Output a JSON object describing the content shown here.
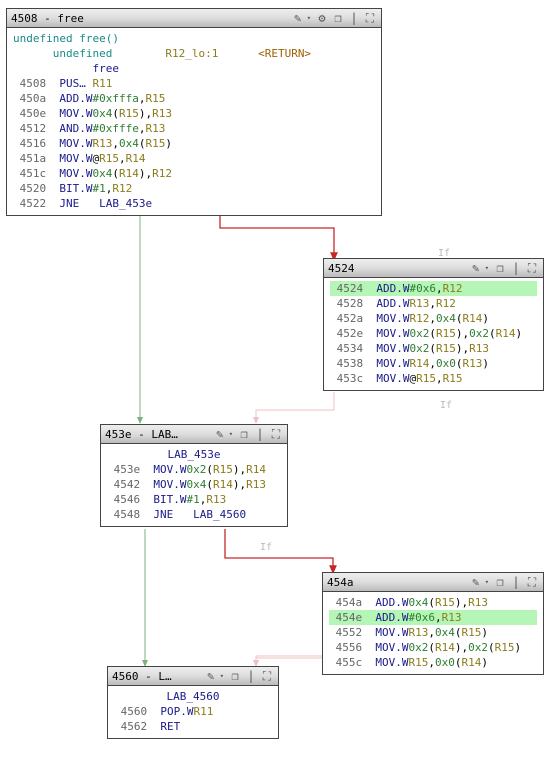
{
  "blocks": {
    "b4508": {
      "title": "4508 - free",
      "sig1": "undefined free()",
      "sig2": {
        "type": "undefined",
        "reg": "R12_lo:1",
        "ret": "<RETURN>"
      },
      "sig3": "free",
      "rows": [
        {
          "a": "4508",
          "t": [
            [
              "op",
              "PUS…"
            ],
            [
              "reg",
              " R11"
            ]
          ]
        },
        {
          "a": "450a",
          "t": [
            [
              "op",
              "ADD.W"
            ],
            [
              "hex",
              "#0xfffa"
            ],
            [
              "",
              ","
            ],
            [
              "reg",
              "R15"
            ]
          ]
        },
        {
          "a": "450e",
          "t": [
            [
              "op",
              "MOV.W"
            ],
            [
              "hex",
              "0x4"
            ],
            [
              "",
              "("
            ],
            [
              "reg",
              "R15"
            ],
            [
              "",
              ")"
            ],
            [
              "",
              ","
            ],
            [
              "reg",
              "R13"
            ]
          ]
        },
        {
          "a": "4512",
          "t": [
            [
              "op",
              "AND.W"
            ],
            [
              "hex",
              "#0xfffe"
            ],
            [
              "",
              ","
            ],
            [
              "reg",
              "R13"
            ]
          ]
        },
        {
          "a": "4516",
          "t": [
            [
              "op",
              "MOV.W"
            ],
            [
              "reg",
              "R13"
            ],
            [
              "",
              ","
            ],
            [
              "hex",
              "0x4"
            ],
            [
              "",
              "("
            ],
            [
              "reg",
              "R15"
            ],
            [
              "",
              ")"
            ]
          ]
        },
        {
          "a": "451a",
          "t": [
            [
              "op",
              "MOV.W"
            ],
            [
              "",
              "@"
            ],
            [
              "reg",
              "R15"
            ],
            [
              "",
              ","
            ],
            [
              "reg",
              "R14"
            ]
          ]
        },
        {
          "a": "451c",
          "t": [
            [
              "op",
              "MOV.W"
            ],
            [
              "hex",
              "0x4"
            ],
            [
              "",
              "("
            ],
            [
              "reg",
              "R14"
            ],
            [
              "",
              ")"
            ],
            [
              "",
              ","
            ],
            [
              "reg",
              "R12"
            ]
          ]
        },
        {
          "a": "4520",
          "t": [
            [
              "op",
              "BIT.W"
            ],
            [
              "hex",
              "#1"
            ],
            [
              "",
              ","
            ],
            [
              "reg",
              "R12"
            ]
          ]
        },
        {
          "a": "4522",
          "t": [
            [
              "op",
              "JNE"
            ],
            [
              "",
              "   "
            ],
            [
              "sym",
              "LAB_453e"
            ]
          ]
        }
      ]
    },
    "b4524": {
      "title": "4524",
      "rows": [
        {
          "a": "4524",
          "hl": true,
          "t": [
            [
              "op",
              "ADD.W"
            ],
            [
              "hex",
              "#0x6"
            ],
            [
              "",
              ","
            ],
            [
              "reg",
              "R12"
            ]
          ]
        },
        {
          "a": "4528",
          "t": [
            [
              "op",
              "ADD.W"
            ],
            [
              "reg",
              "R13"
            ],
            [
              "",
              ","
            ],
            [
              "reg",
              "R12"
            ]
          ]
        },
        {
          "a": "452a",
          "t": [
            [
              "op",
              "MOV.W"
            ],
            [
              "reg",
              "R12"
            ],
            [
              "",
              ","
            ],
            [
              "hex",
              "0x4"
            ],
            [
              "",
              "("
            ],
            [
              "reg",
              "R14"
            ],
            [
              "",
              ")"
            ]
          ]
        },
        {
          "a": "452e",
          "t": [
            [
              "op",
              "MOV.W"
            ],
            [
              "hex",
              "0x2"
            ],
            [
              "",
              "("
            ],
            [
              "reg",
              "R15"
            ],
            [
              "",
              ")"
            ],
            [
              "",
              ","
            ],
            [
              "hex",
              "0x2"
            ],
            [
              "",
              "("
            ],
            [
              "reg",
              "R14"
            ],
            [
              "",
              ")"
            ]
          ]
        },
        {
          "a": "4534",
          "t": [
            [
              "op",
              "MOV.W"
            ],
            [
              "hex",
              "0x2"
            ],
            [
              "",
              "("
            ],
            [
              "reg",
              "R15"
            ],
            [
              "",
              ")"
            ],
            [
              "",
              ","
            ],
            [
              "reg",
              "R13"
            ]
          ]
        },
        {
          "a": "4538",
          "t": [
            [
              "op",
              "MOV.W"
            ],
            [
              "reg",
              "R14"
            ],
            [
              "",
              ","
            ],
            [
              "hex",
              "0x0"
            ],
            [
              "",
              "("
            ],
            [
              "reg",
              "R13"
            ],
            [
              "",
              ")"
            ]
          ]
        },
        {
          "a": "453c",
          "t": [
            [
              "op",
              "MOV.W"
            ],
            [
              "",
              "@"
            ],
            [
              "reg",
              "R15"
            ],
            [
              "",
              ","
            ],
            [
              "reg",
              "R15"
            ]
          ]
        }
      ]
    },
    "b453e": {
      "title": "453e - LAB…",
      "label": "LAB_453e",
      "rows": [
        {
          "a": "453e",
          "t": [
            [
              "op",
              "MOV.W"
            ],
            [
              "hex",
              "0x2"
            ],
            [
              "",
              "("
            ],
            [
              "reg",
              "R15"
            ],
            [
              "",
              ")"
            ],
            [
              "",
              ","
            ],
            [
              "reg",
              "R14"
            ]
          ]
        },
        {
          "a": "4542",
          "t": [
            [
              "op",
              "MOV.W"
            ],
            [
              "hex",
              "0x4"
            ],
            [
              "",
              "("
            ],
            [
              "reg",
              "R14"
            ],
            [
              "",
              ")"
            ],
            [
              "",
              ","
            ],
            [
              "reg",
              "R13"
            ]
          ]
        },
        {
          "a": "4546",
          "t": [
            [
              "op",
              "BIT.W"
            ],
            [
              "hex",
              "#1"
            ],
            [
              "",
              ","
            ],
            [
              "reg",
              "R13"
            ]
          ]
        },
        {
          "a": "4548",
          "t": [
            [
              "op",
              "JNE"
            ],
            [
              "",
              "   "
            ],
            [
              "sym",
              "LAB_4560"
            ]
          ]
        }
      ]
    },
    "b454a": {
      "title": "454a",
      "rows": [
        {
          "a": "454a",
          "t": [
            [
              "op",
              "ADD.W"
            ],
            [
              "hex",
              "0x4"
            ],
            [
              "",
              "("
            ],
            [
              "reg",
              "R15"
            ],
            [
              "",
              ")"
            ],
            [
              "",
              ","
            ],
            [
              "reg",
              "R13"
            ]
          ]
        },
        {
          "a": "454e",
          "hl": true,
          "t": [
            [
              "op",
              "ADD.W"
            ],
            [
              "hex",
              "#0x6"
            ],
            [
              "",
              ","
            ],
            [
              "reg",
              "R13"
            ]
          ]
        },
        {
          "a": "4552",
          "t": [
            [
              "op",
              "MOV.W"
            ],
            [
              "reg",
              "R13"
            ],
            [
              "",
              ","
            ],
            [
              "hex",
              "0x4"
            ],
            [
              "",
              "("
            ],
            [
              "reg",
              "R15"
            ],
            [
              "",
              ")"
            ]
          ]
        },
        {
          "a": "4556",
          "t": [
            [
              "op",
              "MOV.W"
            ],
            [
              "hex",
              "0x2"
            ],
            [
              "",
              "("
            ],
            [
              "reg",
              "R14"
            ],
            [
              "",
              ")"
            ],
            [
              "",
              ","
            ],
            [
              "hex",
              "0x2"
            ],
            [
              "",
              "("
            ],
            [
              "reg",
              "R15"
            ],
            [
              "",
              ")"
            ]
          ]
        },
        {
          "a": "455c",
          "t": [
            [
              "op",
              "MOV.W"
            ],
            [
              "reg",
              "R15"
            ],
            [
              "",
              ","
            ],
            [
              "hex",
              "0x0"
            ],
            [
              "",
              "("
            ],
            [
              "reg",
              "R14"
            ],
            [
              "",
              ")"
            ]
          ]
        }
      ]
    },
    "b4560": {
      "title": "4560 - L…",
      "label": "LAB_4560",
      "rows": [
        {
          "a": "4560",
          "t": [
            [
              "op",
              "POP.W"
            ],
            [
              "reg",
              "R11"
            ]
          ]
        },
        {
          "a": "4562",
          "t": [
            [
              "op",
              "RET"
            ]
          ]
        }
      ]
    }
  },
  "ifLabel": "If"
}
